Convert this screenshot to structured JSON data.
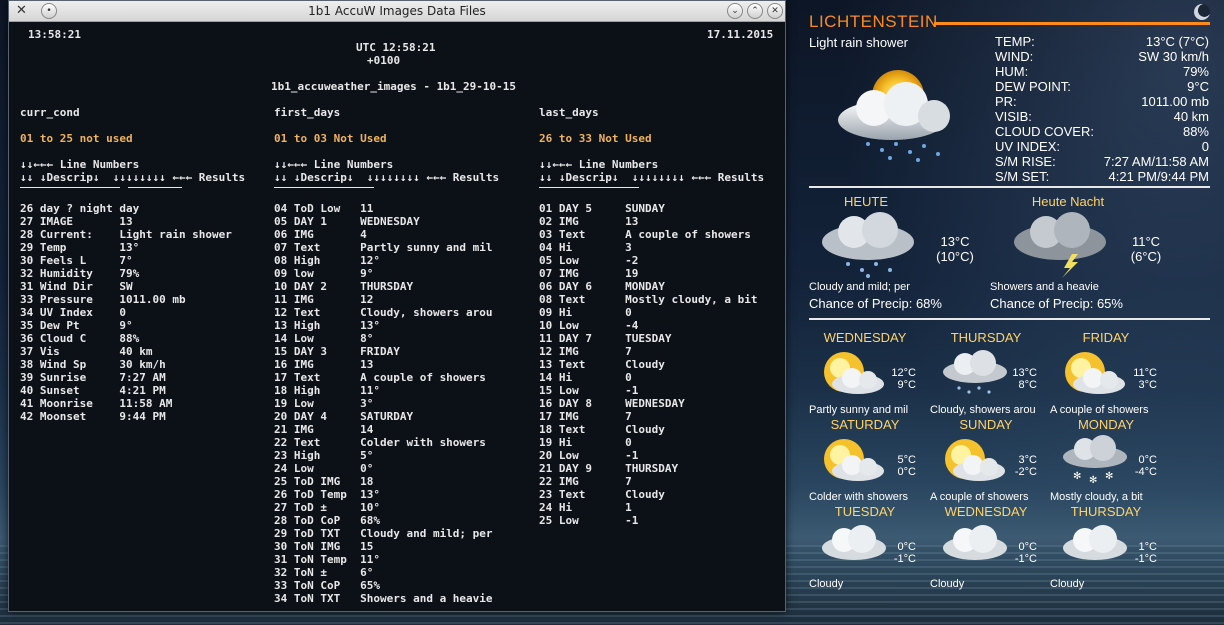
{
  "window": {
    "title": "1b1 AccuW Images Data Files"
  },
  "terminal": {
    "local_time": "13:58:21",
    "utc": "UTC 12:58:21",
    "offset": "+0100",
    "date": "17.11.2015",
    "subtitle": "1b1_accuweather_images - 1b1_29-10-15",
    "columns": [
      {
        "name": "curr_cond",
        "note": "01 to 25 not used",
        "hdr1": "↓↓←←← Line Numbers",
        "hdr2": "↓↓ ↓Descrip↓  ↓↓↓↓↓↓↓↓ ←←← Results",
        "rows": [
          "26 day ? night day",
          "27 IMAGE       13",
          "28 Current:    Light rain shower",
          "29 Temp        13°",
          "30 Feels L     7°",
          "32 Humidity    79%",
          "31 Wind Dir    SW",
          "33 Pressure    1011.00 mb",
          "34 UV Index    0",
          "35 Dew Pt      9°",
          "36 Cloud C     88%",
          "37 Vis         40 km",
          "38 Wind Sp     30 km/h",
          "39 Sunrise     7:27 AM",
          "40 Sunset      4:21 PM",
          "41 Moonrise    11:58 AM",
          "42 Moonset     9:44 PM"
        ]
      },
      {
        "name": "first_days",
        "note": "01 to 03 Not Used",
        "hdr1": "↓↓←←← Line Numbers",
        "hdr2": "↓↓ ↓Descrip↓  ↓↓↓↓↓↓↓↓ ←←← Results",
        "rows": [
          "04 ToD Low   11",
          "05 DAY 1     WEDNESDAY",
          "06 IMG       4",
          "07 Text      Partly sunny and mil",
          "08 High      12°",
          "09 low       9°",
          "10 DAY 2     THURSDAY",
          "11 IMG       12",
          "12 Text      Cloudy, showers arou",
          "13 High      13°",
          "14 Low       8°",
          "15 DAY 3     FRIDAY",
          "16 IMG       13",
          "17 Text      A couple of showers",
          "18 High      11°",
          "19 Low       3°",
          "20 DAY 4     SATURDAY",
          "21 IMG       14",
          "22 Text      Colder with showers",
          "23 High      5°",
          "24 Low       0°",
          "25 ToD IMG   18",
          "26 ToD Temp  13°",
          "27 ToD ±     10°",
          "28 ToD CoP   68%",
          "29 ToD TXT   Cloudy and mild; per",
          "30 ToN IMG   15",
          "31 ToN Temp  11°",
          "32 ToN ±     6°",
          "33 ToN CoP   65%",
          "34 ToN TXT   Showers and a heavie"
        ]
      },
      {
        "name": "last_days",
        "note": "26 to 33 Not Used",
        "hdr1": "↓↓←←← Line Numbers",
        "hdr2": "↓↓ ↓Descrip↓  ↓↓↓↓↓↓↓↓ ←←← Results",
        "rows": [
          "01 DAY 5     SUNDAY",
          "02 IMG       13",
          "03 Text      A couple of showers",
          "04 Hi        3",
          "05 Low       -2",
          "07 IMG       19",
          "06 DAY 6     MONDAY",
          "08 Text      Mostly cloudy, a bit",
          "09 Hi        0",
          "10 Low       -4",
          "11 DAY 7     TUESDAY",
          "12 IMG       7",
          "13 Text      Cloudy",
          "14 Hi        0",
          "15 Low       -1",
          "16 DAY 8     WEDNESDAY",
          "17 IMG       7",
          "18 Text      Cloudy",
          "19 Hi        0",
          "20 Low       -1",
          "21 DAY 9     THURSDAY",
          "22 IMG       7",
          "23 Text      Cloudy",
          "24 Hi        1",
          "25 Low       -1"
        ]
      }
    ]
  },
  "weather": {
    "city": "LICHTENSTEIN",
    "condition": "Light rain shower",
    "stats": [
      {
        "k": "TEMP:",
        "v": "13°C (7°C)"
      },
      {
        "k": "WIND:",
        "v": "SW 30 km/h"
      },
      {
        "k": "HUM:",
        "v": "79%"
      },
      {
        "k": "DEW POINT:",
        "v": "9°C"
      },
      {
        "k": "PR:",
        "v": "1011.00 mb"
      },
      {
        "k": "VISIB:",
        "v": "40 km"
      },
      {
        "k": "CLOUD COVER:",
        "v": "88%"
      },
      {
        "k": "UV INDEX:",
        "v": "0"
      },
      {
        "k": "S/M RISE:",
        "v": "7:27 AM/11:58 AM"
      },
      {
        "k": "S/M SET:",
        "v": "4:21 PM/9:44 PM"
      }
    ],
    "today": {
      "label": "HEUTE",
      "temp": "13°C",
      "feel": "(10°C)",
      "text": "Cloudy and mild; per",
      "precip": "Chance of Precip: 68%"
    },
    "tonight": {
      "label": "Heute Nacht",
      "temp": "11°C",
      "feel": "(6°C)",
      "text": "Showers and a heavie",
      "precip": "Chance of Precip: 65%"
    },
    "forecast": [
      {
        "day": "WEDNESDAY",
        "hi": "12°C",
        "lo": "9°C",
        "text": "Partly sunny and mil",
        "icon": "sun-cloud-icon"
      },
      {
        "day": "THURSDAY",
        "hi": "13°C",
        "lo": "8°C",
        "text": "Cloudy, showers arou",
        "icon": "rain-cloud-icon"
      },
      {
        "day": "FRIDAY",
        "hi": "11°C",
        "lo": "3°C",
        "text": "A couple of showers",
        "icon": "sun-cloud-icon"
      },
      {
        "day": "SATURDAY",
        "hi": "5°C",
        "lo": "0°C",
        "text": "Colder with showers",
        "icon": "sun-cloud-icon"
      },
      {
        "day": "SUNDAY",
        "hi": "3°C",
        "lo": "-2°C",
        "text": "A couple of showers",
        "icon": "sun-cloud-icon"
      },
      {
        "day": "MONDAY",
        "hi": "0°C",
        "lo": "-4°C",
        "text": "Mostly cloudy, a bit",
        "icon": "snow-cloud-icon"
      },
      {
        "day": "TUESDAY",
        "hi": "0°C",
        "lo": "-1°C",
        "text": "Cloudy",
        "icon": "cloud-icon"
      },
      {
        "day": "WEDNESDAY",
        "hi": "0°C",
        "lo": "-1°C",
        "text": "Cloudy",
        "icon": "cloud-icon"
      },
      {
        "day": "THURSDAY",
        "hi": "1°C",
        "lo": "-1°C",
        "text": "Cloudy",
        "icon": "cloud-icon"
      }
    ]
  }
}
